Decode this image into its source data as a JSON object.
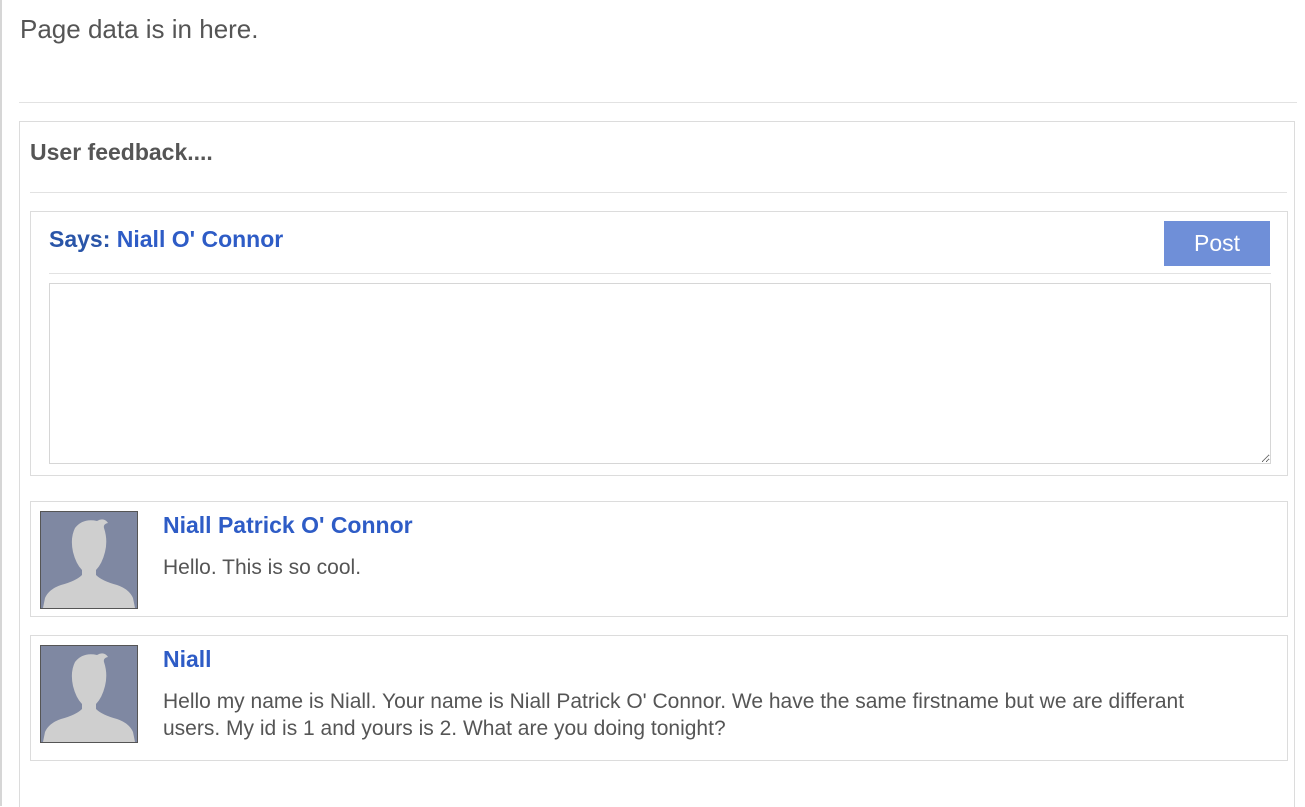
{
  "page": {
    "text": "Page data is in here."
  },
  "feedback": {
    "title": "User feedback....",
    "compose": {
      "says_label": "Says:",
      "user": "Niall O' Connor",
      "post_label": "Post",
      "comment_value": ""
    },
    "comments": [
      {
        "name": "Niall Patrick O' Connor",
        "text": "Hello. This is so cool.",
        "avatar": "default-avatar-icon"
      },
      {
        "name": "Niall",
        "text": "Hello my name is Niall. Your name is Niall Patrick O' Connor. We have the same firstname but we are differant users. My id is 1 and yours is 2. What are you doing tonight?",
        "avatar": "default-avatar-icon"
      }
    ]
  },
  "colors": {
    "link_blue": "#2e5cc6",
    "button_blue": "#6f8fd8",
    "avatar_bg": "#7f88a2"
  }
}
